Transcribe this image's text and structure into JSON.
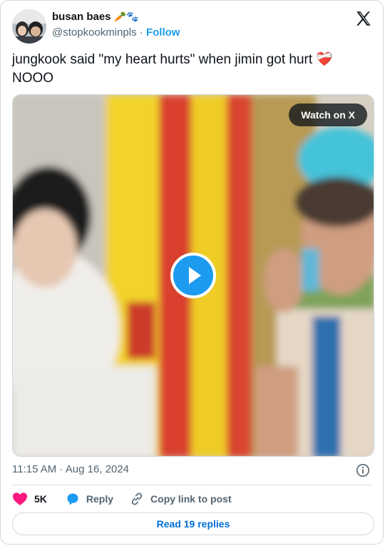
{
  "author": {
    "name": "busan baes",
    "emoji": "🥕🐾",
    "handle": "@stopkookminpls",
    "separator": "·",
    "follow_label": "Follow"
  },
  "tweet": {
    "text": "jungkook said \"my heart hurts\" when jimin got hurt ❤️‍🩹 NOOO"
  },
  "media": {
    "watch_label": "Watch on X"
  },
  "timestamp": "11:15 AM · Aug 16, 2024",
  "actions": {
    "like_count": "5K",
    "reply_label": "Reply",
    "copy_label": "Copy link to post"
  },
  "read_replies_label": "Read 19 replies",
  "colors": {
    "accent": "#1d9bf0",
    "like": "#f91880",
    "text_secondary": "#536471",
    "border": "#cfd9de"
  }
}
